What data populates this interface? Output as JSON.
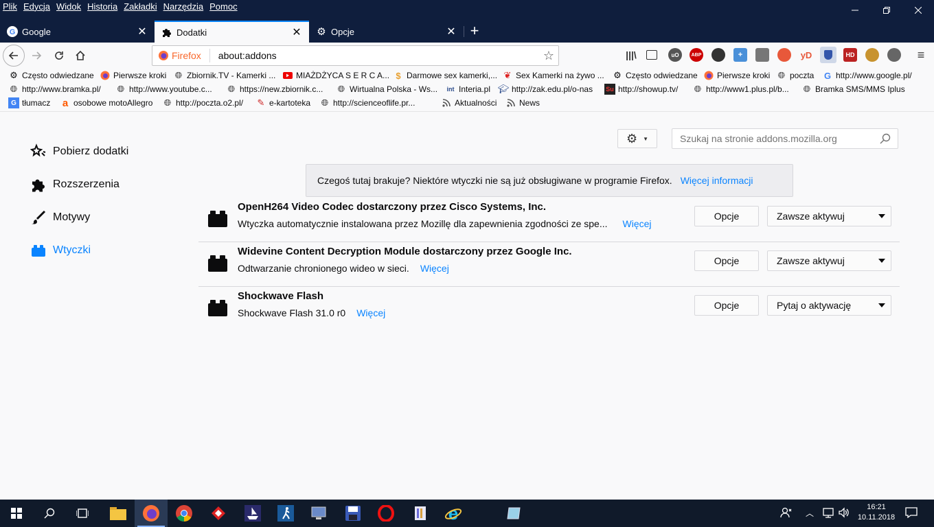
{
  "menu": [
    "Plik",
    "Edycja",
    "Widok",
    "Historia",
    "Zakładki",
    "Narzędzia",
    "Pomoc"
  ],
  "tabs": [
    {
      "title": "Google",
      "icon": "google-icon"
    },
    {
      "title": "Dodatki",
      "icon": "puzzle-icon"
    },
    {
      "title": "Opcje",
      "icon": "gear-icon"
    }
  ],
  "urlbar": {
    "identity": "Firefox",
    "url": "about:addons"
  },
  "bookmarks": {
    "row1": [
      "Często odwiedzane",
      "Pierwsze kroki",
      "Zbiornik.TV - Kamerki ...",
      "MIAŻDŻYCA S E R C A...",
      "Darmowe sex kamerki,...",
      "Sex Kamerki na żywo ...",
      "Często odwiedzane",
      "Pierwsze kroki",
      "poczta",
      "http://www.google.pl/"
    ],
    "row2": [
      "http://www.bramka.pl/",
      "http://www.youtube.c...",
      "https://new.zbiornik.c...",
      "Wirtualna Polska - Ws...",
      "Interia.pl",
      "http://zak.edu.pl/o-nas",
      "http://showup.tv/",
      "http://www1.plus.pl/b...",
      "Bramka SMS/MMS Iplus"
    ],
    "row3": [
      "tłumacz",
      "osobowe motoAllegro",
      "http://poczta.o2.pl/",
      "e-kartoteka",
      "http://scienceoflife.pr...",
      "Aktualności",
      "News"
    ]
  },
  "categories": [
    {
      "label": "Pobierz dodatki",
      "icon": "get-addons-icon"
    },
    {
      "label": "Rozszerzenia",
      "icon": "extensions-puzzle-icon"
    },
    {
      "label": "Motywy",
      "icon": "themes-brush-icon"
    },
    {
      "label": "Wtyczki",
      "icon": "plugins-block-icon"
    }
  ],
  "search": {
    "placeholder": "Szukaj na stronie addons.mozilla.org"
  },
  "notice": {
    "text": "Czegoś tutaj brakuje? Niektóre wtyczki nie są już obsługiwane w programie Firefox.",
    "link": "Więcej informacji"
  },
  "plugins": [
    {
      "name": "OpenH264 Video Codec dostarczony przez Cisco Systems, Inc.",
      "description": "Wtyczka automatycznie instalowana przez Mozillę dla zapewnienia zgodności ze spe...",
      "more": "Więcej",
      "options": "Opcje",
      "state": "Zawsze aktywuj"
    },
    {
      "name": "Widevine Content Decryption Module dostarczony przez Google Inc.",
      "description": "Odtwarzanie chronionego wideo w sieci.",
      "more": "Więcej",
      "options": "Opcje",
      "state": "Zawsze aktywuj"
    },
    {
      "name": "Shockwave Flash",
      "description": "Shockwave Flash 31.0 r0",
      "more": "Więcej",
      "options": "Opcje",
      "state": "Pytaj o aktywację"
    }
  ],
  "clock": {
    "time": "16:21",
    "date": "10.11.2018"
  },
  "colors": {
    "accent": "#0a84ff",
    "titlebar": "#0f1e3d",
    "taskbar": "#101a2a"
  }
}
